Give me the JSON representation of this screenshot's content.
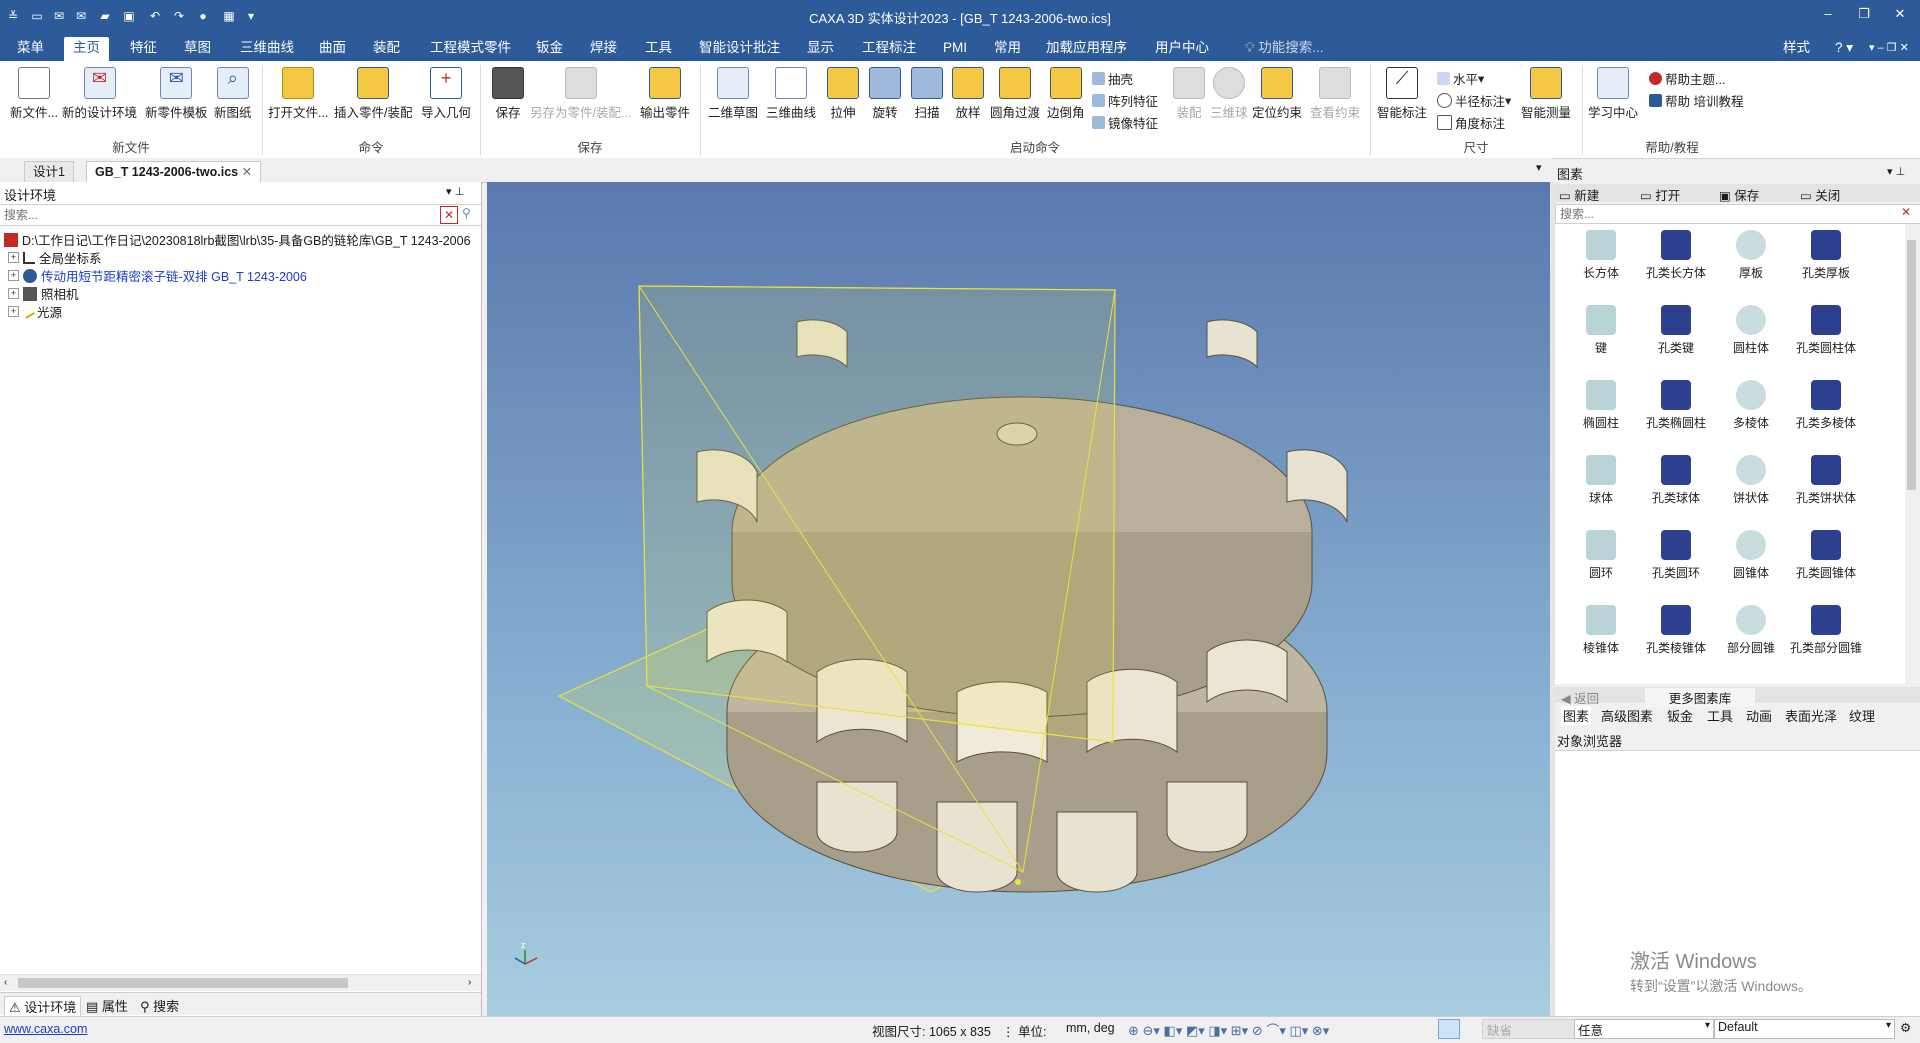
{
  "title": "CAXA 3D 实体设计2023 - [GB_T 1243-2006-two.ics]",
  "menus": [
    "菜单",
    "主页",
    "特征",
    "草图",
    "三维曲线",
    "曲面",
    "装配",
    "工程模式零件",
    "钣金",
    "焊接",
    "工具",
    "智能设计批注",
    "显示",
    "工程标注",
    "PMI",
    "常用",
    "加载应用程序",
    "用户中心"
  ],
  "search_hint": "功能搜索...",
  "style_menu": "样式",
  "ribbon": {
    "new_file": {
      "buttons": [
        "新文件...",
        "新的设计环境",
        "新零件模板",
        "新图纸"
      ],
      "group": "新文件"
    },
    "command": {
      "buttons": [
        "打开文件...",
        "插入零件/装配",
        "导入几何"
      ],
      "group": "命令"
    },
    "save": {
      "buttons": [
        "保存",
        "另存为零件/装配...",
        "输出零件"
      ],
      "group": "保存"
    },
    "start": {
      "buttons": [
        "二维草图",
        "三维曲线",
        "拉伸",
        "旋转",
        "扫描",
        "放样",
        "圆角过渡",
        "边倒角"
      ],
      "small": [
        "抽壳",
        "阵列特征",
        "镜像特征"
      ],
      "extra": [
        "装配",
        "三维球",
        "定位约束",
        "查看约束"
      ],
      "group": "启动命令"
    },
    "dim": {
      "smart": "智能标注",
      "small": [
        "水平",
        "半径标注",
        "角度标注"
      ],
      "measure": "智能测量",
      "group": "尺寸"
    },
    "help": {
      "center": "学习中心",
      "small": [
        "帮助主题...",
        "帮助 培训教程"
      ],
      "group": "帮助/教程"
    }
  },
  "doc_tabs": [
    "设计1",
    "GB_T 1243-2006-two.ics"
  ],
  "left_panel": {
    "title": "设计环境",
    "search_placeholder": "搜索...",
    "tree": [
      "D:\\工作日记\\工作日记\\20230818lrb截图\\lrb\\35-具备GB的链轮库\\GB_T 1243-2006",
      "全局坐标系",
      "传动用短节距精密滚子链-双排 GB_T 1243-2006",
      "照相机",
      "光源"
    ],
    "bottom_tabs": [
      "设计环境",
      "属性",
      "搜索"
    ]
  },
  "right_panel": {
    "title": "图素",
    "toolbar": [
      "新建",
      "打开",
      "保存",
      "关闭"
    ],
    "search_placeholder": "搜索...",
    "items": [
      "长方体",
      "孔类长方体",
      "厚板",
      "孔类厚板",
      "键",
      "孔类键",
      "圆柱体",
      "孔类圆柱体",
      "椭圆柱",
      "孔类椭圆柱",
      "多棱体",
      "孔类多棱体",
      "球体",
      "孔类球体",
      "饼状体",
      "孔类饼状体",
      "圆环",
      "孔类圆环",
      "圆锥体",
      "孔类圆锥体",
      "棱锥体",
      "孔类棱锥体",
      "部分圆锥",
      "孔类部分圆锥"
    ],
    "nav": [
      "返回",
      "更多图素库"
    ],
    "tabs": [
      "图素",
      "高级图素",
      "钣金",
      "工具",
      "动画",
      "表面光泽",
      "纹理"
    ],
    "browser_title": "对象浏览器"
  },
  "watermark": [
    "激活 Windows",
    "转到“设置”以激活 Windows。"
  ],
  "status": {
    "link": "www.caxa.com",
    "view_size": "视图尺寸: 1065 x  835",
    "unit_label": "单位:",
    "unit_value": "mm, deg",
    "field1": "缺省",
    "field2": "任意",
    "field3": "Default"
  },
  "colors": {
    "titlebar": "#2d5b9a",
    "gear": "#bfb6a2",
    "plane": "#e8e23a"
  }
}
